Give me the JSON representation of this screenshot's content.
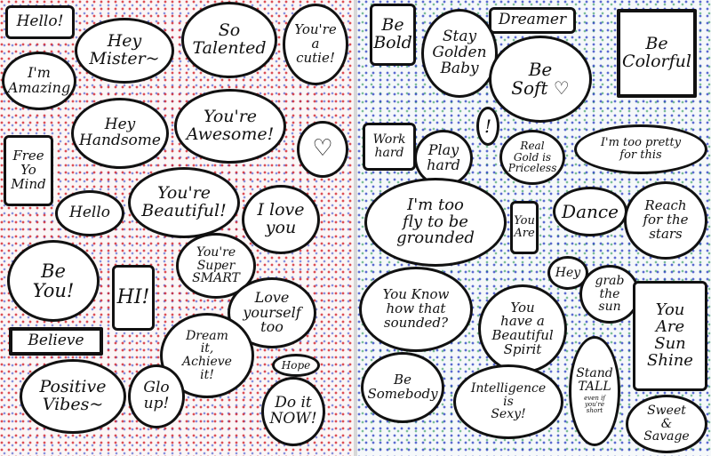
{
  "left_page": [
    {
      "id": "hello",
      "text": "Hello!"
    },
    {
      "id": "im-amazing",
      "text": "I'm\nAmazing"
    },
    {
      "id": "hey-mister",
      "text": "Hey\nMister~"
    },
    {
      "id": "so-talented",
      "text": "So\nTalented"
    },
    {
      "id": "youre-a-cutie",
      "text": "You're\na\ncutie!"
    },
    {
      "id": "hey-handsome",
      "text": "Hey\nHandsome"
    },
    {
      "id": "youre-awesome",
      "text": "You're\nAwesome!"
    },
    {
      "id": "heart",
      "text": "♡"
    },
    {
      "id": "free-yo-mind",
      "text": "Free\nYo\nMind"
    },
    {
      "id": "hello-2",
      "text": "Hello"
    },
    {
      "id": "youre-beautiful",
      "text": "You're\nBeautiful!"
    },
    {
      "id": "i-love-you",
      "text": "I love\nyou"
    },
    {
      "id": "be-you",
      "text": "Be\nYou!"
    },
    {
      "id": "hi",
      "text": "HI!"
    },
    {
      "id": "youre-super-smart",
      "text": "You're\nSuper\nSMART"
    },
    {
      "id": "love-yourself-too",
      "text": "Love\nyourself\ntoo"
    },
    {
      "id": "believe",
      "text": "Believe"
    },
    {
      "id": "dream-it-achieve-it",
      "text": "Dream\nit,\nAchieve\nit!"
    },
    {
      "id": "hope",
      "text": "Hope"
    },
    {
      "id": "positive-vibes",
      "text": "Positive\nVibes~"
    },
    {
      "id": "glo-up",
      "text": "Glo\nup!"
    },
    {
      "id": "do-it-now",
      "text": "Do it\nNOW!"
    }
  ],
  "right_page": [
    {
      "id": "be-bold",
      "text": "Be\nBold"
    },
    {
      "id": "stay-golden-baby",
      "text": "Stay\nGolden\nBaby"
    },
    {
      "id": "dreamer",
      "text": "Dreamer"
    },
    {
      "id": "be-colorful",
      "text": "Be\nColorful"
    },
    {
      "id": "be-soft",
      "text": "Be\nSoft ♡"
    },
    {
      "id": "exclamation",
      "text": "!"
    },
    {
      "id": "work-hard",
      "text": "Work\nhard"
    },
    {
      "id": "play-hard",
      "text": "Play\nhard"
    },
    {
      "id": "real-gold",
      "text": "Real\nGold is\nPriceless"
    },
    {
      "id": "too-pretty",
      "text": "I'm too pretty\nfor this"
    },
    {
      "id": "too-fly",
      "text": "I'm too\nfly to be\ngrounded"
    },
    {
      "id": "you-are",
      "text": "You\nAre"
    },
    {
      "id": "dance",
      "text": "Dance"
    },
    {
      "id": "reach-for-the-stars",
      "text": "Reach\nfor the\nstars"
    },
    {
      "id": "hey",
      "text": "Hey"
    },
    {
      "id": "grab-the-sun",
      "text": "grab\nthe\nsun"
    },
    {
      "id": "you-know",
      "text": "You Know\nhow that\nsounded?"
    },
    {
      "id": "beautiful-spirit",
      "text": "You\nhave a\nBeautiful\nSpirit"
    },
    {
      "id": "you-are-sunshine",
      "text": "You\nAre\nSun\nShine"
    },
    {
      "id": "be-somebody",
      "text": "Be\nSomebody"
    },
    {
      "id": "intelligence-is-sexy",
      "text": "Intelligence\nis\nSexy!"
    },
    {
      "id": "stand-tall",
      "text": "Stand\nTALL"
    },
    {
      "id": "even-if-youre-short",
      "text": "even if\nyou're\nshort"
    },
    {
      "id": "sweet-and-savage",
      "text": "Sweet\n&\nSavage"
    }
  ]
}
